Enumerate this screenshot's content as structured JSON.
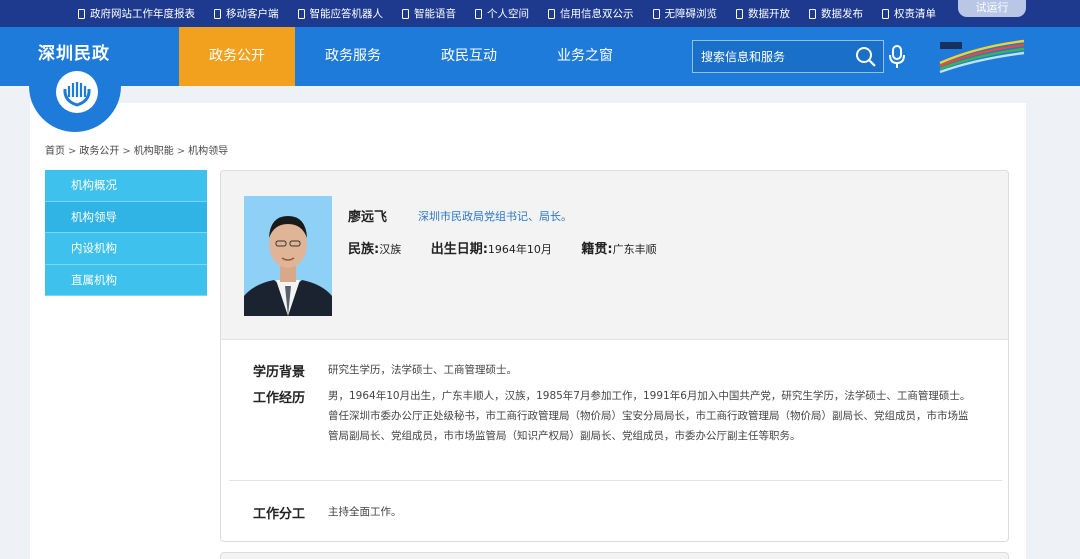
{
  "topbar": {
    "links": [
      {
        "label": "政府网站工作年度报表"
      },
      {
        "label": "移动客户端"
      },
      {
        "label": "智能应答机器人"
      },
      {
        "label": "智能语音"
      },
      {
        "label": "个人空间"
      },
      {
        "label": "信用信息双公示"
      },
      {
        "label": "无障碍浏览"
      },
      {
        "label": "数据开放"
      },
      {
        "label": "数据发布"
      },
      {
        "label": "权责清单"
      }
    ],
    "trial_label": "试运行"
  },
  "header": {
    "site_name": "深圳民政",
    "nav": [
      {
        "label": "政务公开",
        "active": true
      },
      {
        "label": "政务服务",
        "active": false
      },
      {
        "label": "政民互动",
        "active": false
      },
      {
        "label": "业务之窗",
        "active": false
      }
    ],
    "search_placeholder": "搜索信息和服务",
    "colors": {
      "primary": "#1f7bd9",
      "active_tab": "#f2a11f",
      "topbar": "#1d3a8f",
      "sidebar": "#3ec1ec"
    }
  },
  "breadcrumb": [
    "首页",
    "政务公开",
    "机构职能",
    "机构领导"
  ],
  "breadcrumb_sep": ">",
  "sidebar": {
    "items": [
      {
        "label": "机构概况"
      },
      {
        "label": "机构领导"
      },
      {
        "label": "内设机构"
      },
      {
        "label": "直属机构"
      }
    ]
  },
  "profile": {
    "name": "廖远飞",
    "title": "深圳市民政局党组书记、局长。",
    "ethnicity_label": "民族:",
    "ethnicity": "汉族",
    "birth_label": "出生日期:",
    "birth": "1964年10月",
    "origin_label": "籍贯:",
    "origin": "广东丰顺"
  },
  "sections": {
    "education_label": "学历背景",
    "education": "研究生学历，法学硕士、工商管理硕士。",
    "career_label": "工作经历",
    "career": "男，1964年10月出生，广东丰顺人，汉族，1985年7月参加工作，1991年6月加入中国共产党，研究生学历，法学硕士、工商管理硕士。曾任深圳市委办公厅正处级秘书，市工商行政管理局（物价局）宝安分局局长，市工商行政管理局（物价局）副局长、党组成员，市市场监管局副局长、党组成员，市市场监管局（知识产权局）副局长、党组成员，市委办公厅副主任等职务。",
    "duty_label": "工作分工",
    "duty": "主持全面工作。"
  }
}
